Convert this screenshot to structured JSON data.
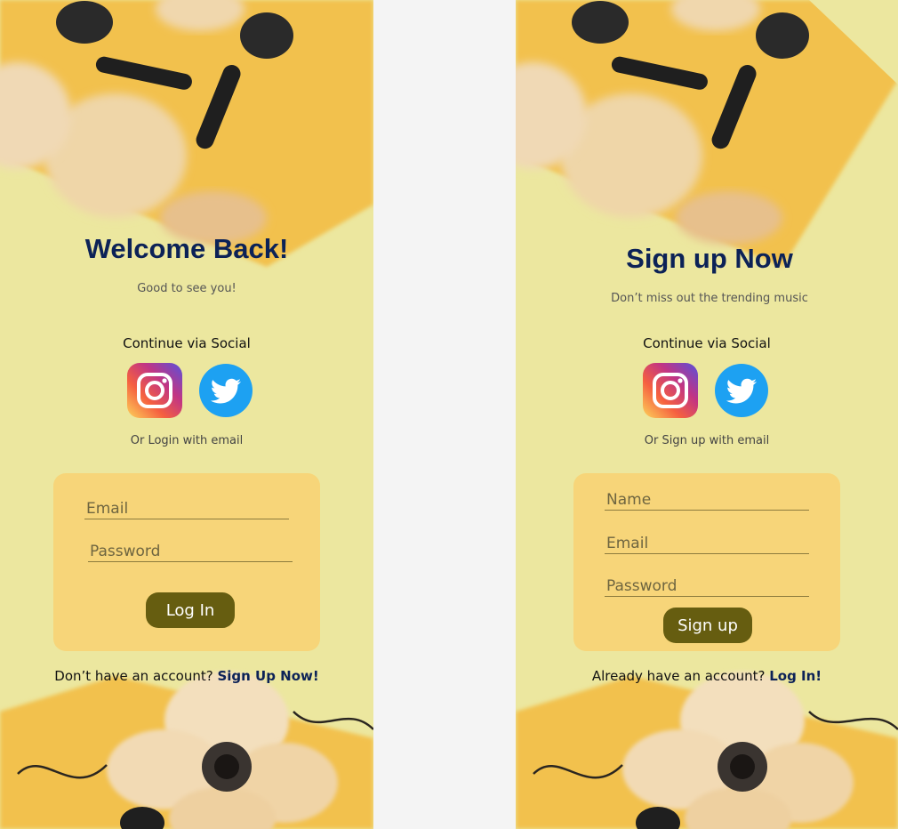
{
  "login": {
    "title": "Welcome Back!",
    "subtitle": "Good to see you!",
    "social_label": "Continue via Social",
    "or_label": "Or Login with email",
    "email_placeholder": "Email",
    "password_placeholder": "Password",
    "submit_label": "Log In",
    "footer_text": "Don’t have an account? ",
    "footer_link": "Sign Up Now!"
  },
  "signup": {
    "title": "Sign up Now",
    "subtitle": "Don’t miss out the trending music",
    "social_label": "Continue via Social",
    "or_label": "Or Sign up with email",
    "name_placeholder": "Name",
    "email_placeholder": "Email",
    "password_placeholder": "Password",
    "submit_label": "Sign up",
    "footer_text": "Already have an account? ",
    "footer_link": "Log In!"
  },
  "icons": {
    "instagram": "instagram-icon",
    "twitter": "twitter-icon"
  },
  "colors": {
    "background": "#ece79f",
    "card": "#f7d579",
    "button": "#665d10",
    "title": "#0c2257",
    "page": "#f4f4f4"
  }
}
